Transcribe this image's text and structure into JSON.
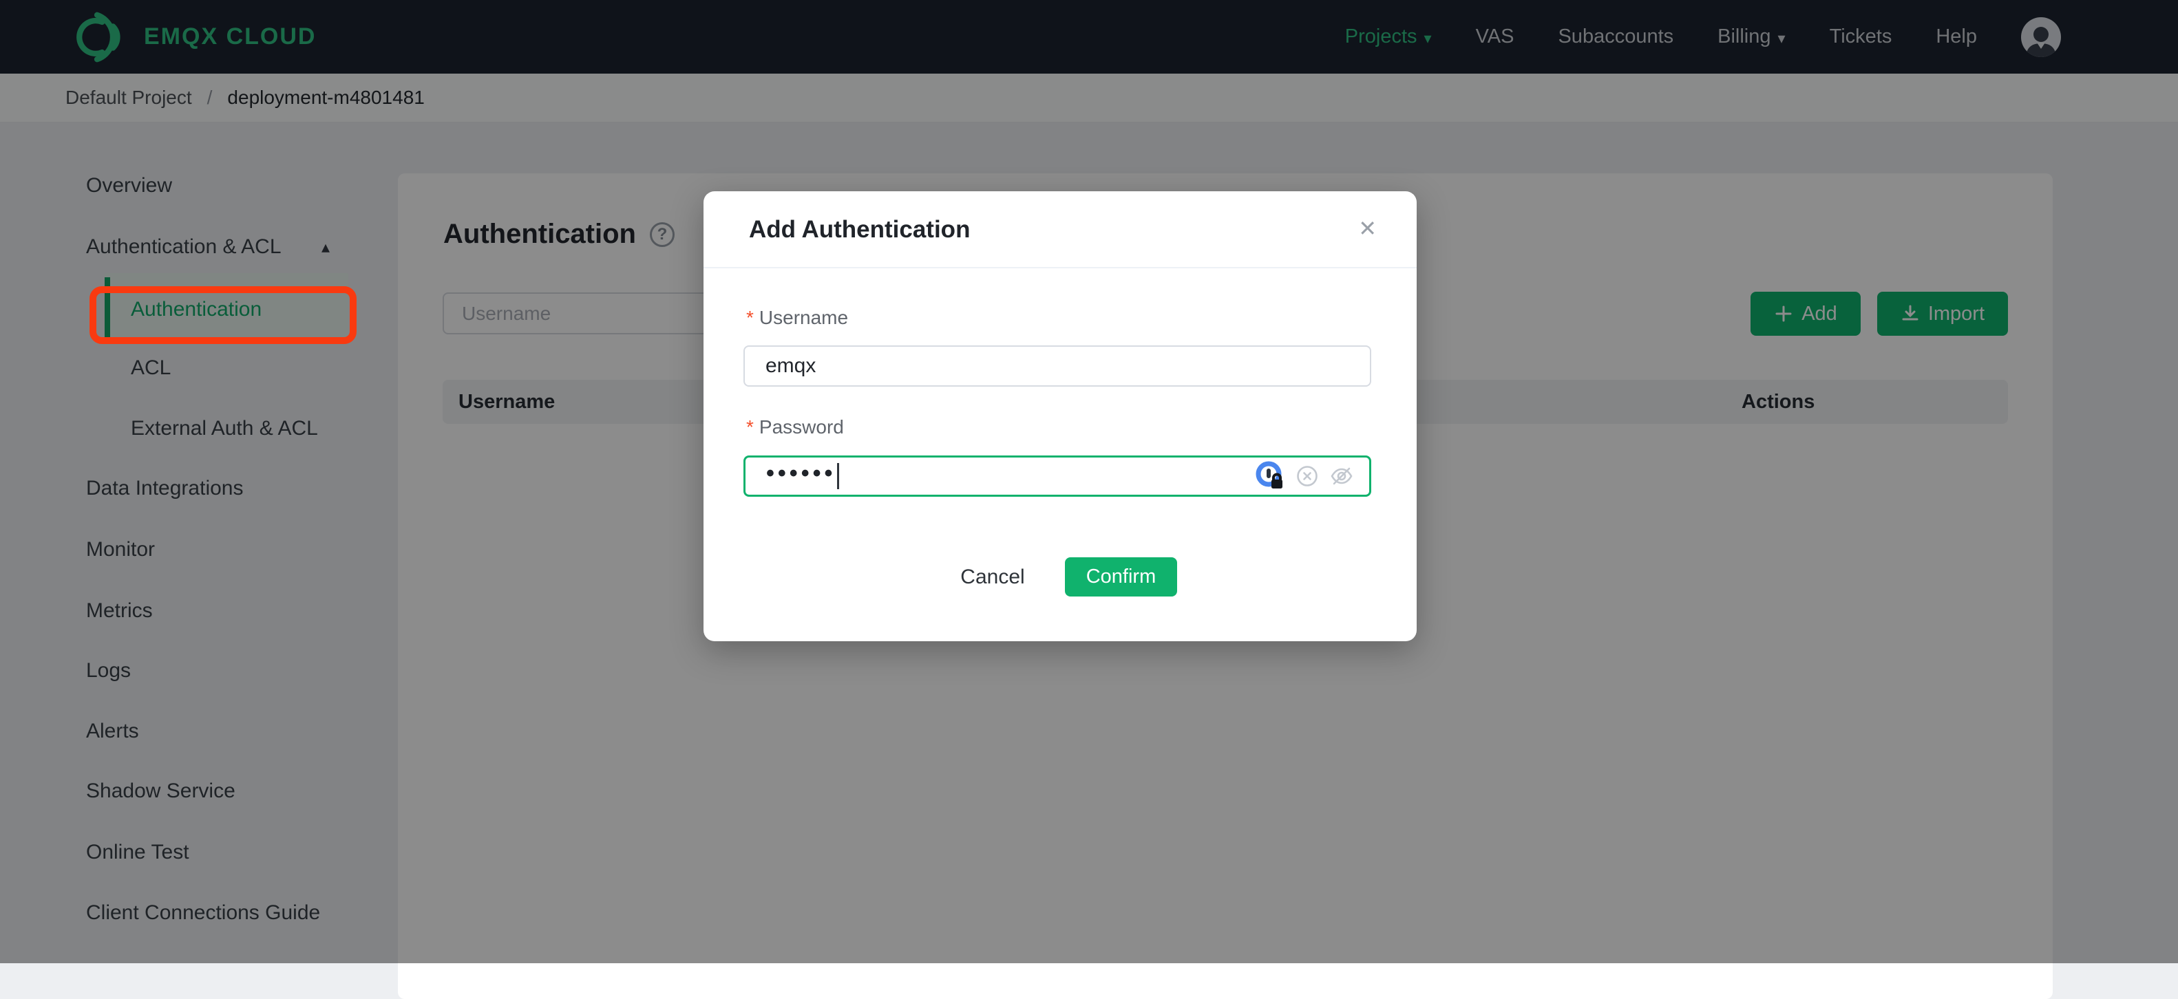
{
  "brand": {
    "logo_text": "EMQX CLOUD"
  },
  "navbar": {
    "items": [
      {
        "label": "Projects",
        "active": true,
        "has_caret": true
      },
      {
        "label": "VAS"
      },
      {
        "label": "Subaccounts"
      },
      {
        "label": "Billing",
        "has_caret": true
      },
      {
        "label": "Tickets"
      },
      {
        "label": "Help"
      }
    ]
  },
  "breadcrumb": {
    "project": "Default Project",
    "separator": "/",
    "deployment": "deployment-m4801481"
  },
  "sidebar": {
    "items": [
      {
        "label": "Overview"
      },
      {
        "label": "Authentication & ACL",
        "expanded": true
      },
      {
        "label": "Authentication",
        "selected": true,
        "annotated": true
      },
      {
        "label": "ACL"
      },
      {
        "label": "External Auth & ACL"
      },
      {
        "label": "Data Integrations"
      },
      {
        "label": "Monitor"
      },
      {
        "label": "Metrics"
      },
      {
        "label": "Logs"
      },
      {
        "label": "Alerts"
      },
      {
        "label": "Shadow Service"
      },
      {
        "label": "Online Test"
      },
      {
        "label": "Client Connections Guide"
      }
    ]
  },
  "main": {
    "title": "Authentication",
    "search_placeholder": "Username",
    "add_label": "Add",
    "import_label": "Import",
    "table": {
      "columns": [
        "Username",
        "Actions"
      ],
      "rows": []
    }
  },
  "modal": {
    "title": "Add Authentication",
    "required_marker": "*",
    "username_label": "Username",
    "username_value": "emqx",
    "password_label": "Password",
    "password_masked": "••••••",
    "cancel_label": "Cancel",
    "confirm_label": "Confirm"
  },
  "icons": {
    "caret_down": "▾",
    "caret_up": "▴",
    "close": "✕",
    "question": "?"
  },
  "colors": {
    "accent_green": "#10b26d",
    "nav_green": "#31c183",
    "annotation_red": "#f93a10",
    "navbar_bg": "#1c2430"
  }
}
